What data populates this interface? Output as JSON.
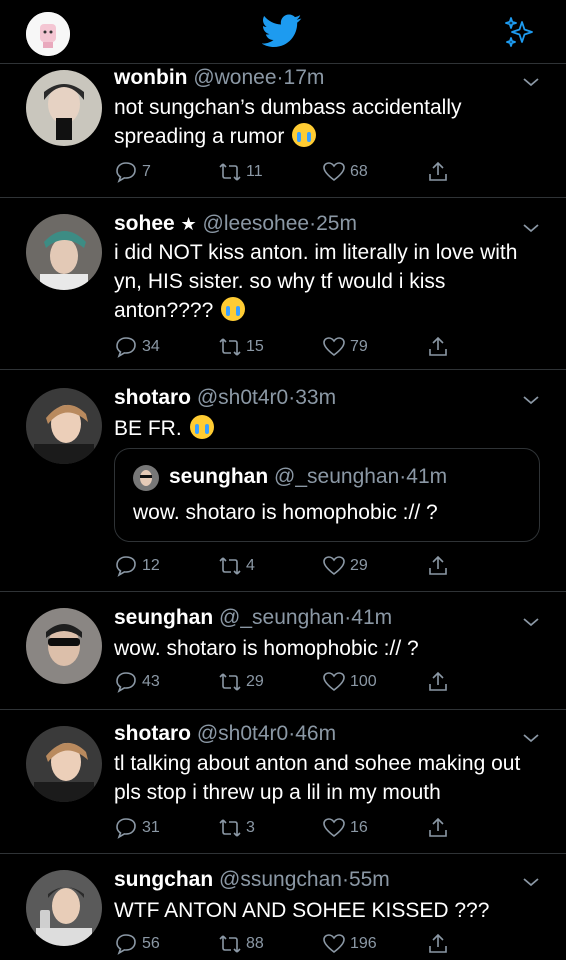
{
  "topbar": {
    "logo": "twitter-bird-icon",
    "left": "profile-avatar",
    "right": "sparkle-icon"
  },
  "tweets": [
    {
      "name": "wonbin",
      "badge": "",
      "handle": "@wonee",
      "time": "17m",
      "text": "not sungchan’s dumbass accidentally spreading a rumor",
      "emoji": true,
      "replies": "7",
      "retweets": "11",
      "likes": "68"
    },
    {
      "name": "sohee",
      "badge": "★",
      "handle": "@leesohee",
      "time": "25m",
      "text": "i did NOT kiss anton. im literally in love with yn, HIS sister. so why tf would i kiss anton????",
      "emoji": true,
      "replies": "34",
      "retweets": "15",
      "likes": "79"
    },
    {
      "name": "shotaro",
      "badge": "",
      "handle": "@sh0t4r0",
      "time": "33m",
      "text": "BE FR.",
      "emoji": true,
      "quote": {
        "name": "seunghan",
        "handle": "@_seunghan",
        "time": "41m",
        "text": "wow. shotaro is homophobic :// ?"
      },
      "replies": "12",
      "retweets": "4",
      "likes": "29"
    },
    {
      "name": "seunghan",
      "badge": "",
      "handle": "@_seunghan",
      "time": "41m",
      "text": "wow. shotaro is homophobic :// ?",
      "emoji": false,
      "replies": "43",
      "retweets": "29",
      "likes": "100"
    },
    {
      "name": "shotaro",
      "badge": "",
      "handle": "@sh0t4r0",
      "time": "46m",
      "text": "tl talking about anton and sohee making out pls stop i threw up a lil in my mouth",
      "emoji": false,
      "replies": "31",
      "retweets": "3",
      "likes": "16"
    },
    {
      "name": "sungchan",
      "badge": "",
      "handle": "@ssungchan",
      "time": "55m",
      "text": "WTF ANTON AND SOHEE KISSED ???",
      "emoji": false,
      "replies": "56",
      "retweets": "88",
      "likes": "196"
    }
  ],
  "colors": {
    "background": "#000000",
    "accent": "#1d9bf0",
    "muted": "#8b98a5",
    "divider": "#2f3336"
  }
}
